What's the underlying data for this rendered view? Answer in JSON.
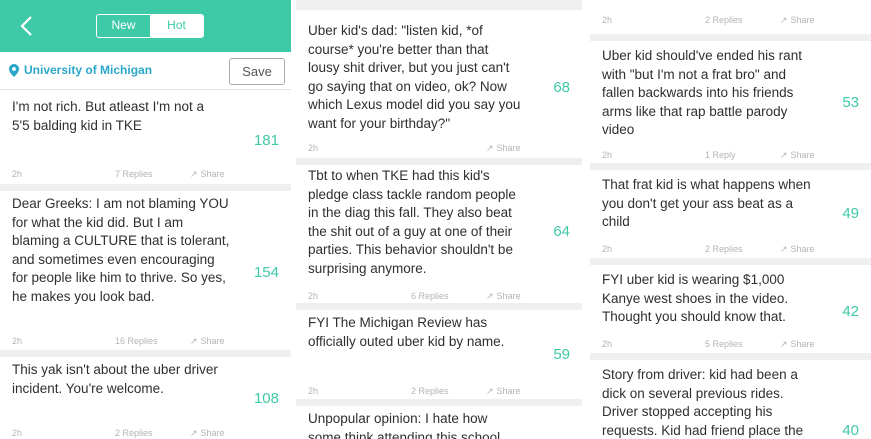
{
  "colors": {
    "accent": "#3ec9a7",
    "location": "#2aa7c9",
    "separator": "#efefef"
  },
  "icons": {
    "back": "chevron-left-icon",
    "pin": "map-pin-icon",
    "share": "share-arrow-icon"
  },
  "header": {
    "tabs": [
      {
        "label": "New",
        "active": false
      },
      {
        "label": "Hot",
        "active": true
      }
    ],
    "location": "University of Michigan",
    "save_label": "Save"
  },
  "panel1": {
    "posts": [
      {
        "text": "I'm not rich. But atleast I'm not a 5'5 balding kid in TKE",
        "score": "181"
      },
      {
        "text": "Dear Greeks: I am not blaming YOU for what the kid did. But I am blaming a CULTURE that is tolerant, and sometimes even encouraging for people like him to thrive. So yes, he makes you look bad.",
        "score": "154"
      },
      {
        "text": "This yak isn't about the uber driver incident. You're welcome.",
        "score": "108"
      }
    ],
    "metas": [
      {
        "time": "2h",
        "replies": "7 Replies",
        "share": "Share"
      },
      {
        "time": "2h",
        "replies": "16 Replies",
        "share": "Share"
      },
      {
        "time": "2h",
        "replies": "2 Replies",
        "share": "Share"
      }
    ]
  },
  "panel2": {
    "posts": [
      {
        "text": "Uber kid's dad: \"listen kid, *of course* you're better than that lousy shit driver, but you just can't go saying that on video, ok? Now which Lexus model did you say you want for your birthday?\"",
        "score": "68"
      },
      {
        "text": "Tbt to when TKE had this kid's pledge class tackle random people in the diag this fall. They also beat the shit out of a guy at one of their parties. This behavior shouldn't be surprising anymore.",
        "score": "64"
      },
      {
        "text": "FYI The Michigan Review has officially outed uber kid by name.",
        "score": "59"
      },
      {
        "text": "Unpopular opinion: I hate how some think attending this school",
        "score": ""
      }
    ],
    "metas": [
      {
        "time": "2h",
        "replies": "",
        "share": "Share"
      },
      {
        "time": "2h",
        "replies": "6 Replies",
        "share": "Share"
      },
      {
        "time": "2h",
        "replies": "2 Replies",
        "share": "Share"
      }
    ]
  },
  "panel3": {
    "top_meta": {
      "time": "2h",
      "replies": "2 Replies",
      "share": "Share"
    },
    "posts": [
      {
        "text": "Uber kid should've ended his rant with \"but I'm not a frat bro\" and fallen backwards into his friends arms like that rap battle parody video",
        "score": "53"
      },
      {
        "text": "That frat kid is what happens when you don't get your ass beat as a child",
        "score": "49"
      },
      {
        "text": "FYI uber kid is wearing $1,000 Kanye west shoes in the video. Thought you should know that.",
        "score": "42"
      },
      {
        "text": "Story from driver: kid had been a dick on several previous rides. Driver stopped accepting his requests. Kid had friend place the",
        "score": "40"
      }
    ],
    "metas": [
      {
        "time": "2h",
        "replies": "1 Reply",
        "share": "Share"
      },
      {
        "time": "2h",
        "replies": "2 Replies",
        "share": "Share"
      },
      {
        "time": "2h",
        "replies": "5 Replies",
        "share": "Share"
      }
    ]
  }
}
